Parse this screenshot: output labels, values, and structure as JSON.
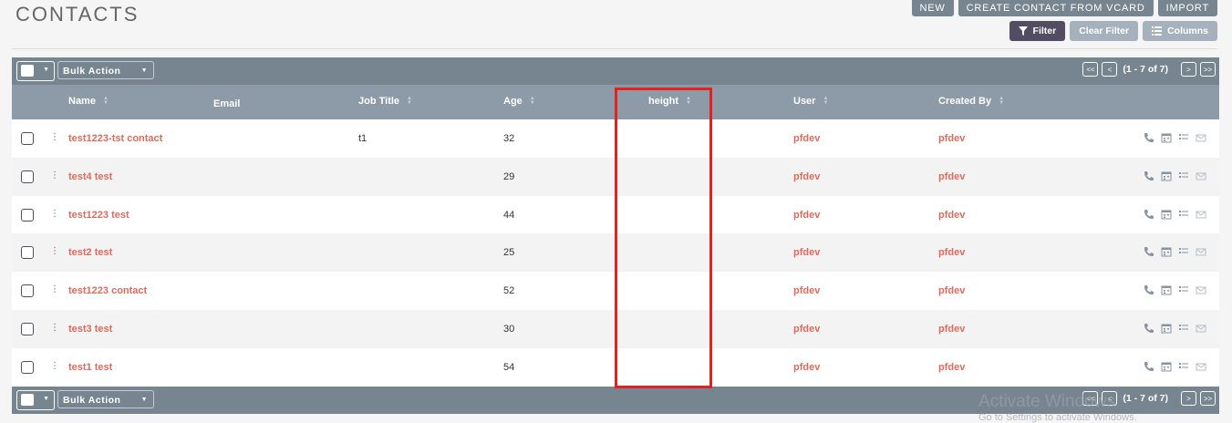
{
  "page": {
    "title": "CONTACTS"
  },
  "top_actions": [
    {
      "label": "NEW"
    },
    {
      "label": "CREATE CONTACT FROM VCARD"
    },
    {
      "label": "IMPORT"
    }
  ],
  "filters": {
    "filter": "Filter",
    "clear": "Clear Filter",
    "columns": "Columns"
  },
  "toolbar": {
    "bulk_action": "Bulk Action",
    "count": "(1 - 7 of 7)",
    "first": "<<",
    "prev": "<",
    "next": ">",
    "last": ">>"
  },
  "columns": {
    "name": "Name",
    "email": "Email",
    "job_title": "Job Title",
    "age": "Age",
    "height": "height",
    "user": "User",
    "created_by": "Created By"
  },
  "rows": [
    {
      "name": "test1223-tst contact",
      "job": "t1",
      "age": "32",
      "user": "pfdev",
      "created_by": "pfdev"
    },
    {
      "name": "test4 test",
      "job": "",
      "age": "29",
      "user": "pfdev",
      "created_by": "pfdev"
    },
    {
      "name": "test1223 test",
      "job": "",
      "age": "44",
      "user": "pfdev",
      "created_by": "pfdev"
    },
    {
      "name": "test2 test",
      "job": "",
      "age": "25",
      "user": "pfdev",
      "created_by": "pfdev"
    },
    {
      "name": "test1223 contact",
      "job": "",
      "age": "52",
      "user": "pfdev",
      "created_by": "pfdev"
    },
    {
      "name": "test3 test",
      "job": "",
      "age": "30",
      "user": "pfdev",
      "created_by": "pfdev"
    },
    {
      "name": "test1 test",
      "job": "",
      "age": "54",
      "user": "pfdev",
      "created_by": "pfdev"
    }
  ],
  "watermark": {
    "line1": "Activate Windows",
    "line2": "Go to Settings to activate Windows."
  },
  "colors": {
    "accent": "#e06b5d",
    "toolbar": "#778591",
    "header": "#8d9aa7",
    "highlight": "#e32121"
  }
}
